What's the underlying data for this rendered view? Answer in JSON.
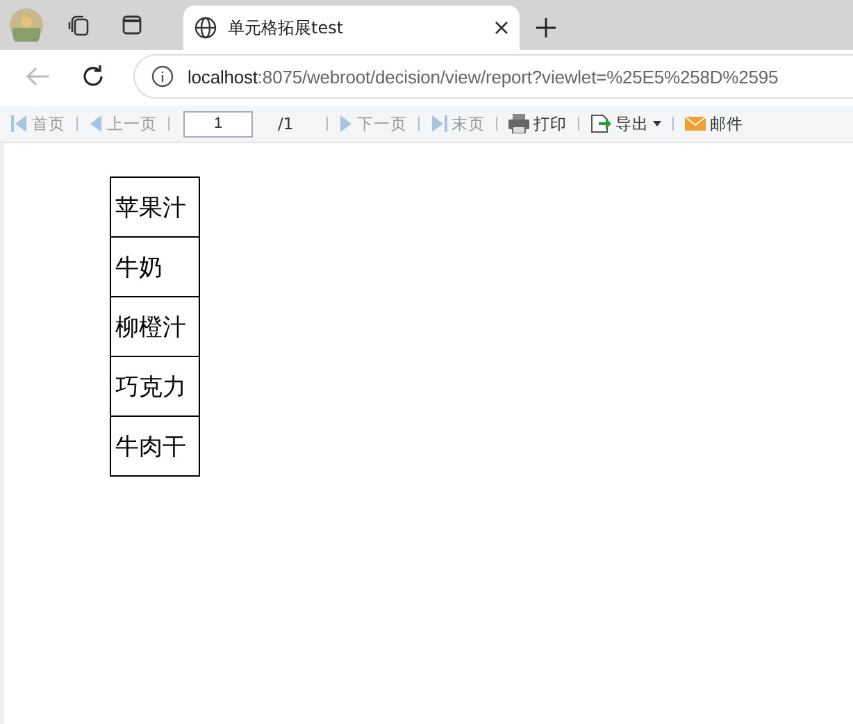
{
  "browser": {
    "tabs": [
      {
        "title": "单元格拓展test",
        "selected": true
      }
    ],
    "address": {
      "host": "localhost",
      "rest": ":8075/webroot/decision/view/report?viewlet=%25E5%258D%2595"
    }
  },
  "toolbar": {
    "items": [
      {
        "kind": "first",
        "label": "首页",
        "disabled": true
      },
      {
        "kind": "prev",
        "label": "上一页",
        "disabled": true
      },
      {
        "kind": "page",
        "value": "1",
        "total": "/1"
      },
      {
        "kind": "next",
        "label": "下一页",
        "disabled": true
      },
      {
        "kind": "last",
        "label": "末页",
        "disabled": true
      },
      {
        "kind": "print",
        "label": "打印",
        "disabled": false
      },
      {
        "kind": "export",
        "label": "导出",
        "disabled": false
      },
      {
        "kind": "mail",
        "label": "邮件",
        "disabled": false
      }
    ]
  },
  "report": {
    "rows": [
      "苹果汁",
      "牛奶",
      "柳橙汁",
      "巧克力",
      "牛肉干"
    ]
  }
}
